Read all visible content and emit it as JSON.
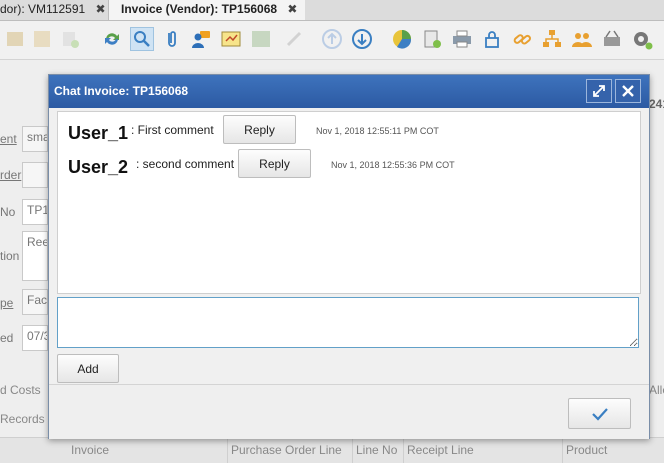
{
  "tabs": [
    {
      "label": "dor): VM112591",
      "close": "✖"
    },
    {
      "label": "Invoice (Vendor): TP156068",
      "close": "✖"
    }
  ],
  "form": {
    "labels": [
      "ent",
      "rder",
      "No",
      "tion",
      "pe",
      "ed"
    ],
    "values": [
      "sma",
      "",
      "TP1",
      "Ree",
      "Fac",
      "07/3"
    ],
    "sections": [
      "d Costs",
      "Records"
    ],
    "right_fragments": [
      "241",
      "Alle"
    ]
  },
  "grid": {
    "columns": [
      "Invoice",
      "Purchase Order Line",
      "Line No",
      "Receipt Line",
      "Product"
    ]
  },
  "dialog": {
    "title": "Chat Invoice: TP156068",
    "messages": [
      {
        "user": "User_1",
        "text": ": First comment",
        "reply_label": "Reply",
        "timestamp": "Nov 1, 2018 12:55:11 PM COT"
      },
      {
        "user": "User_2",
        "text": ": second comment",
        "reply_label": "Reply",
        "timestamp": "Nov 1, 2018 12:55:36 PM COT"
      }
    ],
    "composer_placeholder": "",
    "add_label": "Add"
  },
  "colors": {
    "accent": "#2c5aa3",
    "highlight": "#ff5a2a"
  },
  "toolbar_icons": [
    "undo-icon",
    "save-icon",
    "new-icon",
    "refresh-icon",
    "search-icon",
    "attachment-icon",
    "chat-icon",
    "note-icon",
    "grid-icon",
    "zoom-icon",
    "up-icon",
    "down-icon",
    "report-icon",
    "archive-icon",
    "print-icon",
    "lock-icon",
    "link-icon",
    "workflow-icon",
    "users-icon",
    "basket-icon",
    "settings-icon"
  ]
}
